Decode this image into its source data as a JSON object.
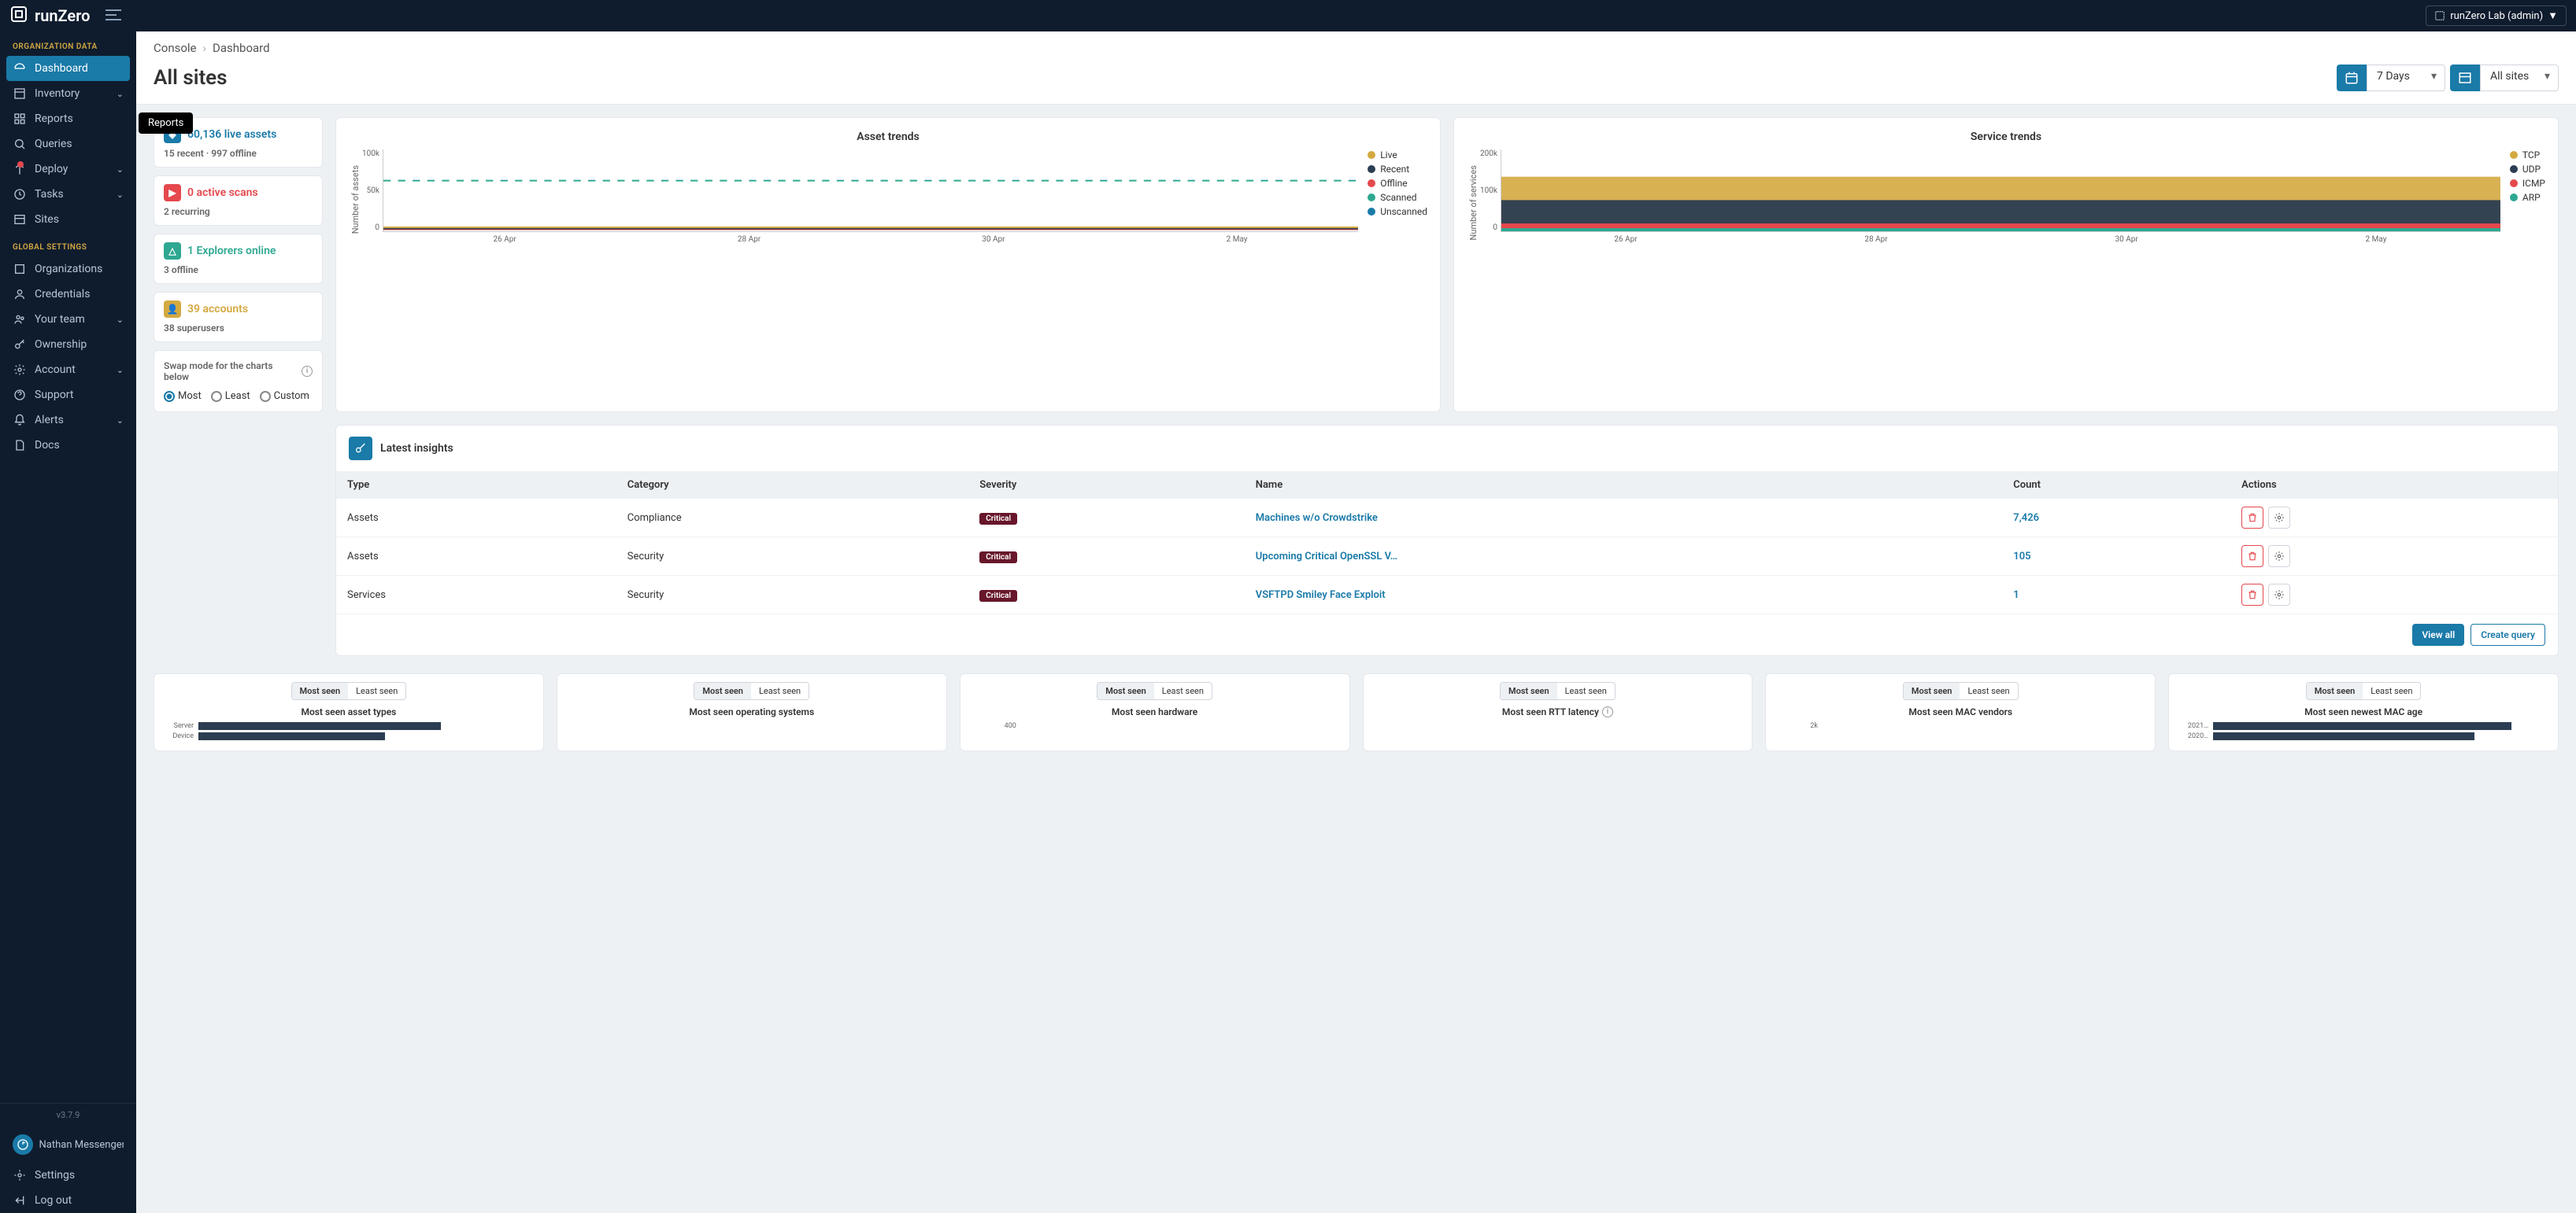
{
  "header": {
    "brand": "runZero",
    "org_selector": "runZero Lab (admin)"
  },
  "sidebar": {
    "sections": {
      "org": "ORGANIZATION DATA",
      "global": "GLOBAL SETTINGS"
    },
    "items": {
      "dashboard": "Dashboard",
      "inventory": "Inventory",
      "reports": "Reports",
      "queries": "Queries",
      "deploy": "Deploy",
      "tasks": "Tasks",
      "sites": "Sites",
      "organizations": "Organizations",
      "credentials": "Credentials",
      "yourteam": "Your team",
      "ownership": "Ownership",
      "account": "Account",
      "support": "Support",
      "alerts": "Alerts",
      "docs": "Docs"
    },
    "version": "v3.7.9",
    "user": "Nathan Messenger",
    "settings": "Settings",
    "logout": "Log out",
    "tooltip": "Reports"
  },
  "breadcrumb": {
    "root": "Console",
    "page": "Dashboard"
  },
  "page": {
    "title": "All sites",
    "range": "7 Days",
    "site_filter": "All sites"
  },
  "stats": {
    "live": {
      "value": "60,136 live assets",
      "sub": "15 recent · 997 offline"
    },
    "scans": {
      "value": "0 active scans",
      "sub": "2 recurring"
    },
    "explorers": {
      "value": "1 Explorers online",
      "sub": "3 offline"
    },
    "accounts": {
      "value": "39 accounts",
      "sub": "38 superusers"
    }
  },
  "swap": {
    "label": "Swap mode for the charts below",
    "opts": {
      "most": "Most",
      "least": "Least",
      "custom": "Custom"
    }
  },
  "chart_data": [
    {
      "type": "line",
      "title": "Asset trends",
      "ylabel": "Number of assets",
      "yticks": [
        "100k",
        "50k",
        "0"
      ],
      "xticks": [
        "26 Apr",
        "28 Apr",
        "30 Apr",
        "2 May"
      ],
      "series": [
        {
          "name": "Live",
          "color": "#d4a940"
        },
        {
          "name": "Recent",
          "color": "#2b3d52"
        },
        {
          "name": "Offline",
          "color": "#e5484d"
        },
        {
          "name": "Scanned",
          "color": "#2ea891"
        },
        {
          "name": "Unscanned",
          "color": "#1a7aa8"
        }
      ]
    },
    {
      "type": "area",
      "title": "Service trends",
      "ylabel": "Number of services",
      "yticks": [
        "200k",
        "100k",
        "0"
      ],
      "xticks": [
        "26 Apr",
        "28 Apr",
        "30 Apr",
        "2 May"
      ],
      "series": [
        {
          "name": "TCP",
          "color": "#d4a940"
        },
        {
          "name": "UDP",
          "color": "#2b3d52"
        },
        {
          "name": "ICMP",
          "color": "#e5484d"
        },
        {
          "name": "ARP",
          "color": "#2ea891"
        }
      ]
    }
  ],
  "insights": {
    "title": "Latest insights",
    "columns": [
      "Type",
      "Category",
      "Severity",
      "Name",
      "Count",
      "Actions"
    ],
    "rows": [
      {
        "type": "Assets",
        "category": "Compliance",
        "severity": "Critical",
        "name": "Machines w/o Crowdstrike",
        "count": "7,426"
      },
      {
        "type": "Assets",
        "category": "Security",
        "severity": "Critical",
        "name": "Upcoming Critical OpenSSL V…",
        "count": "105"
      },
      {
        "type": "Services",
        "category": "Security",
        "severity": "Critical",
        "name": "VSFTPD Smiley Face Exploit",
        "count": "1"
      }
    ],
    "view_all": "View all",
    "create_query": "Create query"
  },
  "small": {
    "toggle": {
      "most": "Most seen",
      "least": "Least seen"
    },
    "titles": {
      "asset_types": "Most seen asset types",
      "os": "Most seen operating systems",
      "hardware": "Most seen hardware",
      "rtt": "Most seen RTT latency",
      "mac_vendors": "Most seen MAC vendors",
      "mac_age": "Most seen newest MAC age"
    },
    "bars": {
      "asset_types": [
        "Server",
        "Device"
      ],
      "hardware_tick": "400",
      "mac_vendors_tick": "2k",
      "mac_age": [
        "2021…",
        "2020…"
      ]
    }
  }
}
